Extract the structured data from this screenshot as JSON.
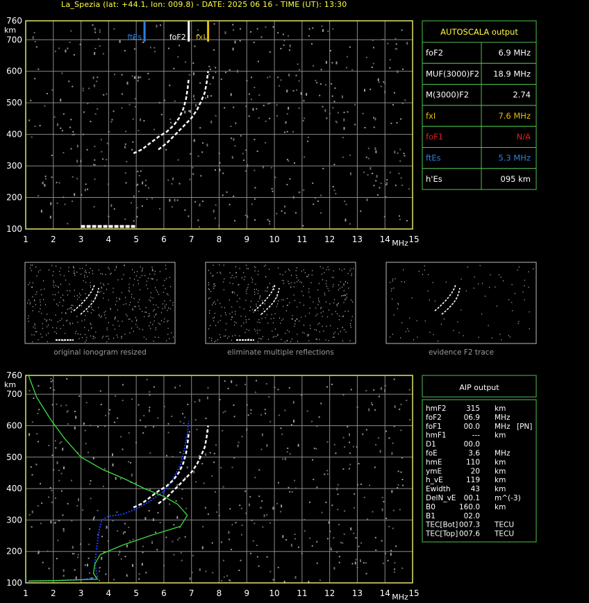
{
  "header": {
    "title": "La_Spezia (lat: +44.1, lon: 009.8) - DATE: 2025 06 16 - TIME (UT): 13:30"
  },
  "colors": {
    "axis": "#e5e56a",
    "grid": "#8a8a8a",
    "fxl": "#e5c000",
    "ftes": "#2f7fe0",
    "foF1": "#e02020",
    "green": "#40e040",
    "blue": "#1f3fff",
    "box": "#4fc24f"
  },
  "chart_data": [
    {
      "type": "scatter",
      "name": "ionogram",
      "xlim": [
        1,
        15
      ],
      "ylim": [
        100,
        760
      ],
      "xticks": [
        1,
        2,
        3,
        4,
        5,
        6,
        7,
        8,
        9,
        10,
        11,
        12,
        13,
        14,
        15
      ],
      "yticks": [
        100,
        200,
        300,
        400,
        500,
        600,
        700,
        760
      ],
      "xlabel": "MHz",
      "ylabel": "km",
      "markers": [
        {
          "label": "ftEs",
          "x": 5.3,
          "color": "ftes"
        },
        {
          "label": "foF2",
          "x": 6.9,
          "color": "white"
        },
        {
          "label": "fxI",
          "x": 7.6,
          "color": "fxl"
        }
      ],
      "trace_o": [
        [
          4.9,
          340
        ],
        [
          5.2,
          352
        ],
        [
          5.5,
          372
        ],
        [
          5.8,
          392
        ],
        [
          6.1,
          408
        ],
        [
          6.35,
          428
        ],
        [
          6.55,
          452
        ],
        [
          6.7,
          480
        ],
        [
          6.8,
          512
        ],
        [
          6.86,
          545
        ],
        [
          6.9,
          575
        ]
      ],
      "trace_x": [
        [
          5.8,
          352
        ],
        [
          6.1,
          372
        ],
        [
          6.4,
          398
        ],
        [
          6.7,
          425
        ],
        [
          7.0,
          452
        ],
        [
          7.2,
          478
        ],
        [
          7.35,
          505
        ],
        [
          7.48,
          532
        ],
        [
          7.55,
          565
        ],
        [
          7.6,
          600
        ]
      ],
      "es_trace": [
        [
          3.0,
          108
        ],
        [
          3.4,
          108
        ],
        [
          3.8,
          108
        ],
        [
          4.2,
          108
        ],
        [
          4.6,
          108
        ],
        [
          5.0,
          108
        ]
      ]
    },
    {
      "type": "line",
      "name": "aip",
      "xlim": [
        1,
        15
      ],
      "ylim": [
        100,
        760
      ],
      "xticks": [
        1,
        2,
        3,
        4,
        5,
        6,
        7,
        8,
        9,
        10,
        11,
        12,
        13,
        14,
        15
      ],
      "yticks": [
        100,
        200,
        300,
        400,
        500,
        600,
        700,
        760
      ],
      "xlabel": "MHz",
      "ylabel": "km",
      "profile_green": [
        [
          1.1,
          760
        ],
        [
          1.4,
          690
        ],
        [
          1.9,
          620
        ],
        [
          2.4,
          560
        ],
        [
          3.0,
          500
        ],
        [
          3.8,
          460
        ],
        [
          4.6,
          430
        ],
        [
          5.3,
          400
        ],
        [
          6.0,
          375
        ],
        [
          6.5,
          350
        ],
        [
          6.85,
          315
        ],
        [
          6.6,
          280
        ],
        [
          5.5,
          250
        ],
        [
          4.5,
          220
        ],
        [
          3.7,
          190
        ],
        [
          3.5,
          160
        ],
        [
          3.45,
          130
        ],
        [
          3.6,
          112
        ],
        [
          3.0,
          110
        ],
        [
          2.0,
          107
        ],
        [
          1.1,
          106
        ]
      ],
      "profile_blue": [
        [
          1.0,
          105
        ],
        [
          2.0,
          107
        ],
        [
          3.0,
          110
        ],
        [
          3.6,
          118
        ],
        [
          3.5,
          160
        ],
        [
          3.55,
          200
        ],
        [
          3.6,
          230
        ],
        [
          3.65,
          260
        ],
        [
          3.75,
          300
        ],
        [
          4.0,
          312
        ],
        [
          4.5,
          318
        ],
        [
          5.0,
          335
        ],
        [
          5.5,
          360
        ],
        [
          6.0,
          392
        ],
        [
          6.3,
          425
        ],
        [
          6.6,
          475
        ],
        [
          6.75,
          530
        ],
        [
          6.85,
          575
        ],
        [
          6.9,
          615
        ]
      ],
      "trace_o": [
        [
          4.9,
          340
        ],
        [
          5.2,
          352
        ],
        [
          5.5,
          372
        ],
        [
          5.8,
          392
        ],
        [
          6.1,
          408
        ],
        [
          6.35,
          428
        ],
        [
          6.55,
          452
        ],
        [
          6.7,
          480
        ],
        [
          6.8,
          512
        ],
        [
          6.86,
          545
        ],
        [
          6.9,
          575
        ]
      ],
      "trace_x": [
        [
          5.8,
          352
        ],
        [
          6.1,
          372
        ],
        [
          6.4,
          398
        ],
        [
          6.7,
          425
        ],
        [
          7.0,
          452
        ],
        [
          7.2,
          478
        ],
        [
          7.35,
          505
        ],
        [
          7.48,
          532
        ],
        [
          7.55,
          565
        ],
        [
          7.6,
          600
        ]
      ]
    }
  ],
  "autoscala": {
    "title": "AUTOSCALA output",
    "rows": [
      {
        "label": "foF2",
        "value": "6.9 MHz",
        "color": "white"
      },
      {
        "label": "MUF(3000)F2",
        "value": "18.9 MHz",
        "color": "white"
      },
      {
        "label": "M(3000)F2",
        "value": "2.74",
        "color": "white"
      },
      {
        "label": "fxI",
        "value": "7.6 MHz",
        "color": "fxl"
      },
      {
        "label": "foF1",
        "value": "N/A",
        "color": "foF1"
      },
      {
        "label": "ftEs",
        "value": "5.3 MHz",
        "color": "ftes"
      },
      {
        "label": "h'Es",
        "value": "095     km",
        "color": "white"
      }
    ]
  },
  "thumbnails": [
    {
      "caption": "original ionogram resized"
    },
    {
      "caption": "eliminate multiple reflections"
    },
    {
      "caption": "evidence F2 trace"
    }
  ],
  "aip": {
    "title": "AIP output",
    "rows": [
      [
        "hmF2",
        "315",
        "km",
        ""
      ],
      [
        "foF2",
        "06.9",
        "MHz",
        ""
      ],
      [
        "foF1",
        "00.0",
        "MHz",
        "[PN]"
      ],
      [
        "hmF1",
        "---",
        "km",
        ""
      ],
      [
        "D1",
        "00.0",
        "",
        ""
      ],
      [
        "foE",
        "3.6",
        "MHz",
        ""
      ],
      [
        "hmE",
        "110",
        "km",
        ""
      ],
      [
        "ymE",
        "20",
        "km",
        ""
      ],
      [
        "h_vE",
        "119",
        "km",
        ""
      ],
      [
        "Ewidth",
        "43",
        "km",
        ""
      ],
      [
        "DelN_vE",
        "00.1",
        "m^(-3)",
        ""
      ],
      [
        "B0",
        "160.0",
        "km",
        ""
      ],
      [
        "B1",
        "02.0",
        "",
        ""
      ],
      [
        "TEC[Bot]",
        "007.3",
        "TECU",
        ""
      ],
      [
        "TEC[Top]",
        "007.6",
        "TECU",
        ""
      ]
    ]
  }
}
